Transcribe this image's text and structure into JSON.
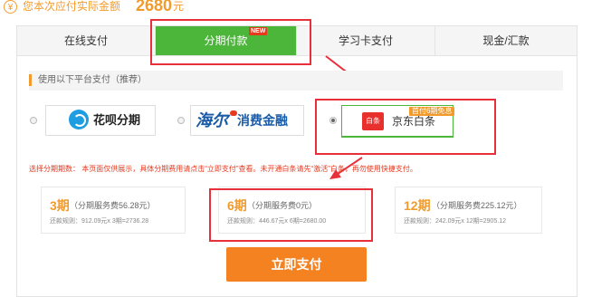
{
  "amount_line": {
    "label": "您本次应付实际金额",
    "amount": "2680",
    "unit": "元",
    "icon": "yen-icon"
  },
  "tabs": [
    {
      "label": "在线支付",
      "active": false
    },
    {
      "label": "分期付款",
      "active": true,
      "badge": "NEW"
    },
    {
      "label": "学习卡支付",
      "active": false
    },
    {
      "label": "现金/汇款",
      "active": false
    }
  ],
  "platform_section": {
    "title": "使用以下平台支付（推荐）",
    "options": [
      {
        "name": "花呗分期",
        "selected": false
      },
      {
        "name": "海尔消费金融",
        "logo_mark": "海尔",
        "text": "消费金融",
        "selected": false
      },
      {
        "name": "京东白条",
        "logo": "白条",
        "promo": "首付6期免息",
        "selected": true
      }
    ]
  },
  "notice": {
    "label": "选择分期期数：",
    "text": "本页面仅供展示，具体分期费用请点击“立即支付”查看。未开通白条请先“激活”白条，再勿使用快捷支付。"
  },
  "installments": [
    {
      "period": "3期",
      "fee": "（分期服务费56.28元）",
      "rule": "还款规则：912.09元x 3期=2736.28"
    },
    {
      "period": "6期",
      "fee": "（分期服务费0元）",
      "rule": "还款规则：446.67元x 6期=2680.00"
    },
    {
      "period": "12期",
      "fee": "（分期服务费225.12元）",
      "rule": "还款规则：242.09元x 12期=2905.12"
    }
  ],
  "pay_button": "立即支付",
  "colors": {
    "accent_orange": "#f29b2c",
    "tab_green": "#4cb63a",
    "button_orange": "#f58220",
    "annotation_red": "#e8303a"
  }
}
